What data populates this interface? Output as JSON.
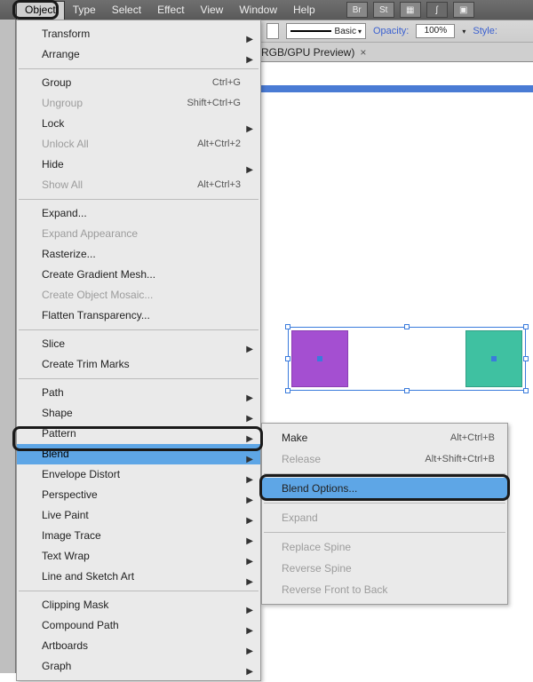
{
  "menubar": {
    "items": [
      "Object",
      "Type",
      "Select",
      "Effect",
      "View",
      "Window",
      "Help"
    ],
    "open_index": 0
  },
  "toolbar": {
    "stroke_label": "Basic",
    "opacity_label": "Opacity:",
    "opacity_value": "100%",
    "style_label": "Style:"
  },
  "tab": {
    "label": "(RGB/GPU Preview)"
  },
  "object_menu": [
    {
      "label": "Transform",
      "arrow": true
    },
    {
      "label": "Arrange",
      "arrow": true
    },
    {
      "sep": true
    },
    {
      "label": "Group",
      "shortcut": "Ctrl+G"
    },
    {
      "label": "Ungroup",
      "shortcut": "Shift+Ctrl+G",
      "disabled": true
    },
    {
      "label": "Lock",
      "arrow": true
    },
    {
      "label": "Unlock All",
      "shortcut": "Alt+Ctrl+2",
      "disabled": true
    },
    {
      "label": "Hide",
      "arrow": true
    },
    {
      "label": "Show All",
      "shortcut": "Alt+Ctrl+3",
      "disabled": true
    },
    {
      "sep": true
    },
    {
      "label": "Expand..."
    },
    {
      "label": "Expand Appearance",
      "disabled": true
    },
    {
      "label": "Rasterize..."
    },
    {
      "label": "Create Gradient Mesh..."
    },
    {
      "label": "Create Object Mosaic...",
      "disabled": true
    },
    {
      "label": "Flatten Transparency..."
    },
    {
      "sep": true
    },
    {
      "label": "Slice",
      "arrow": true
    },
    {
      "label": "Create Trim Marks"
    },
    {
      "sep": true
    },
    {
      "label": "Path",
      "arrow": true
    },
    {
      "label": "Shape",
      "arrow": true
    },
    {
      "label": "Pattern",
      "arrow": true
    },
    {
      "label": "Blend",
      "arrow": true,
      "hl": true
    },
    {
      "label": "Envelope Distort",
      "arrow": true
    },
    {
      "label": "Perspective",
      "arrow": true
    },
    {
      "label": "Live Paint",
      "arrow": true
    },
    {
      "label": "Image Trace",
      "arrow": true
    },
    {
      "label": "Text Wrap",
      "arrow": true
    },
    {
      "label": "Line and Sketch Art",
      "arrow": true
    },
    {
      "sep": true
    },
    {
      "label": "Clipping Mask",
      "arrow": true
    },
    {
      "label": "Compound Path",
      "arrow": true
    },
    {
      "label": "Artboards",
      "arrow": true
    },
    {
      "label": "Graph",
      "arrow": true
    }
  ],
  "blend_submenu": [
    {
      "label": "Make",
      "shortcut": "Alt+Ctrl+B"
    },
    {
      "label": "Release",
      "shortcut": "Alt+Shift+Ctrl+B",
      "disabled": true
    },
    {
      "sep": true
    },
    {
      "label": "Blend Options...",
      "hl": true
    },
    {
      "sep": true
    },
    {
      "label": "Expand",
      "disabled": true
    },
    {
      "sep": true
    },
    {
      "label": "Replace Spine",
      "disabled": true
    },
    {
      "label": "Reverse Spine",
      "disabled": true
    },
    {
      "label": "Reverse Front to Back",
      "disabled": true
    }
  ],
  "shapes": {
    "color1": "#a44fd1",
    "color2": "#3fc1a1"
  }
}
